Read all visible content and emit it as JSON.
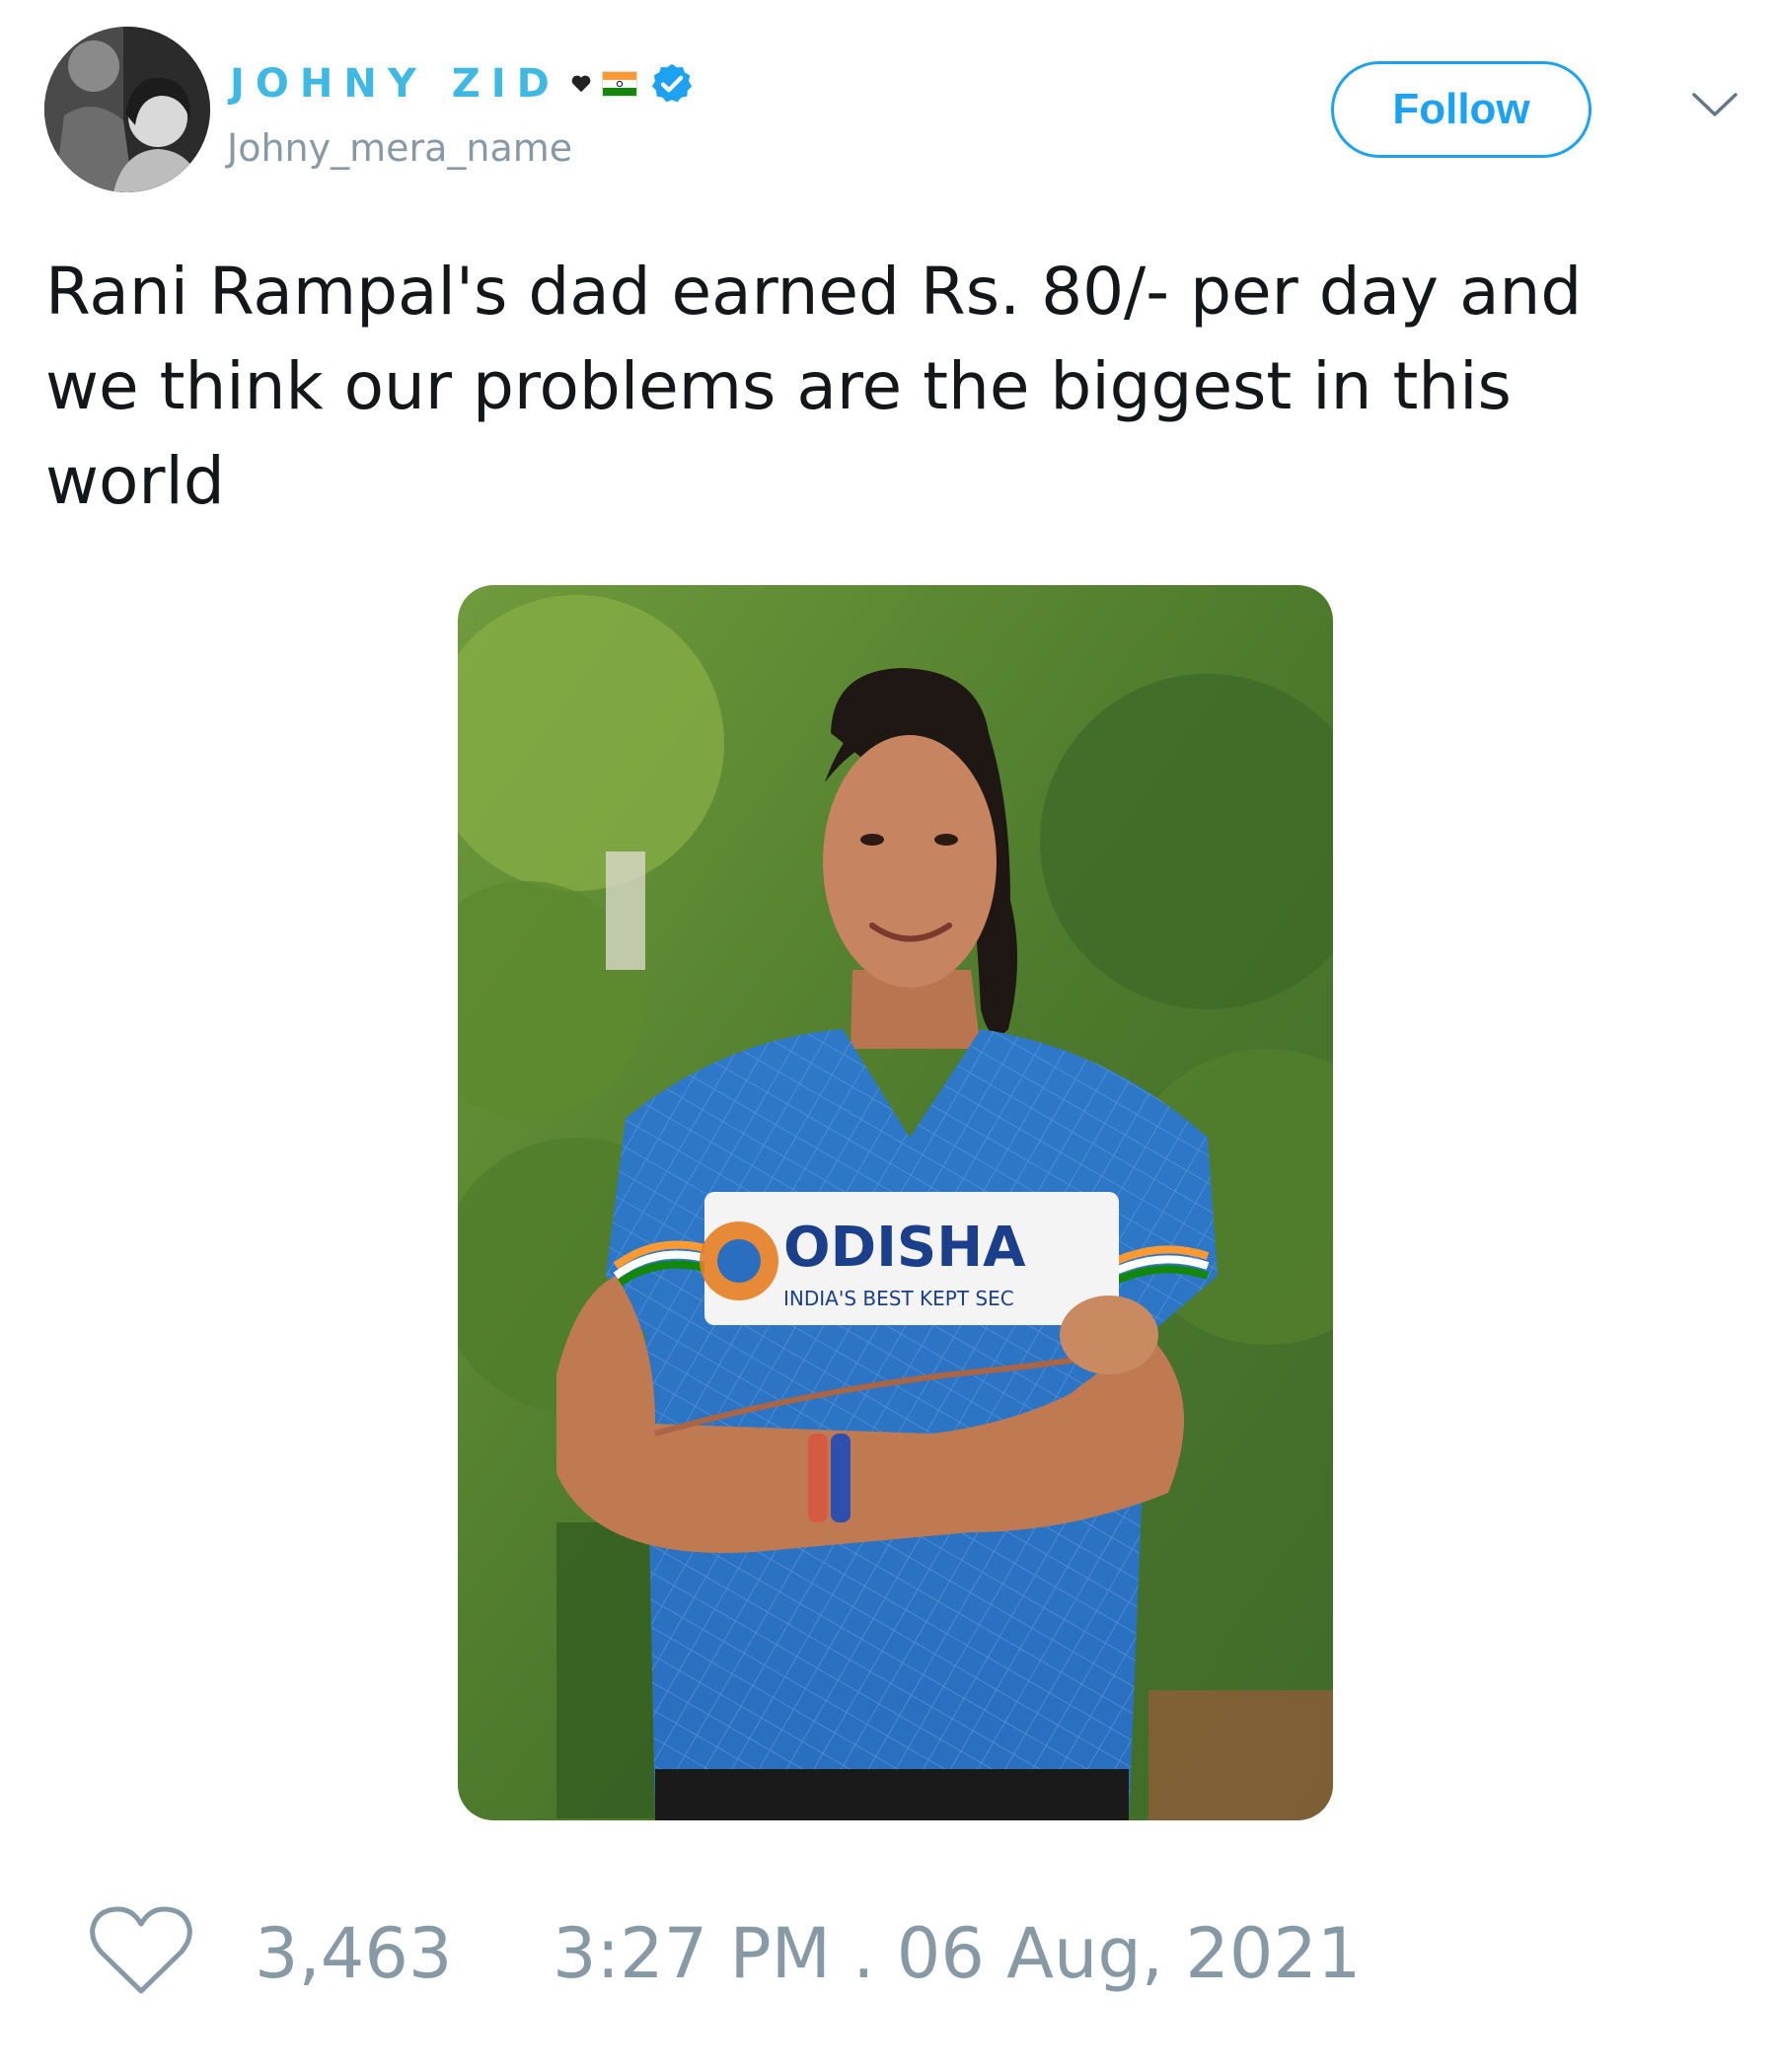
{
  "user": {
    "display_name": "JOHNY ZID",
    "handle": "Johny_mera_name",
    "emoji": [
      "heart-emoji",
      "india-flag-emoji"
    ],
    "verified": true,
    "avatar_icon": "user-avatar"
  },
  "actions": {
    "follow_label": "Follow",
    "menu_icon": "chevron-down-icon"
  },
  "tweet": {
    "text": "Rani Rampal's dad earned Rs. 80/- per day and\nwe think our problems are the biggest in this\nworld",
    "media": {
      "jersey_brand": "ODISHA",
      "jersey_tagline": "INDIA'S BEST KEPT SEC"
    }
  },
  "footer": {
    "like_icon": "heart-outline-icon",
    "like_count": "3,463",
    "timestamp": "3:27 PM . 06 Aug, 2021"
  },
  "colors": {
    "accent": "#1da1f2",
    "name": "#3fb9e4",
    "muted": "#8899a6",
    "text": "#14171a"
  }
}
